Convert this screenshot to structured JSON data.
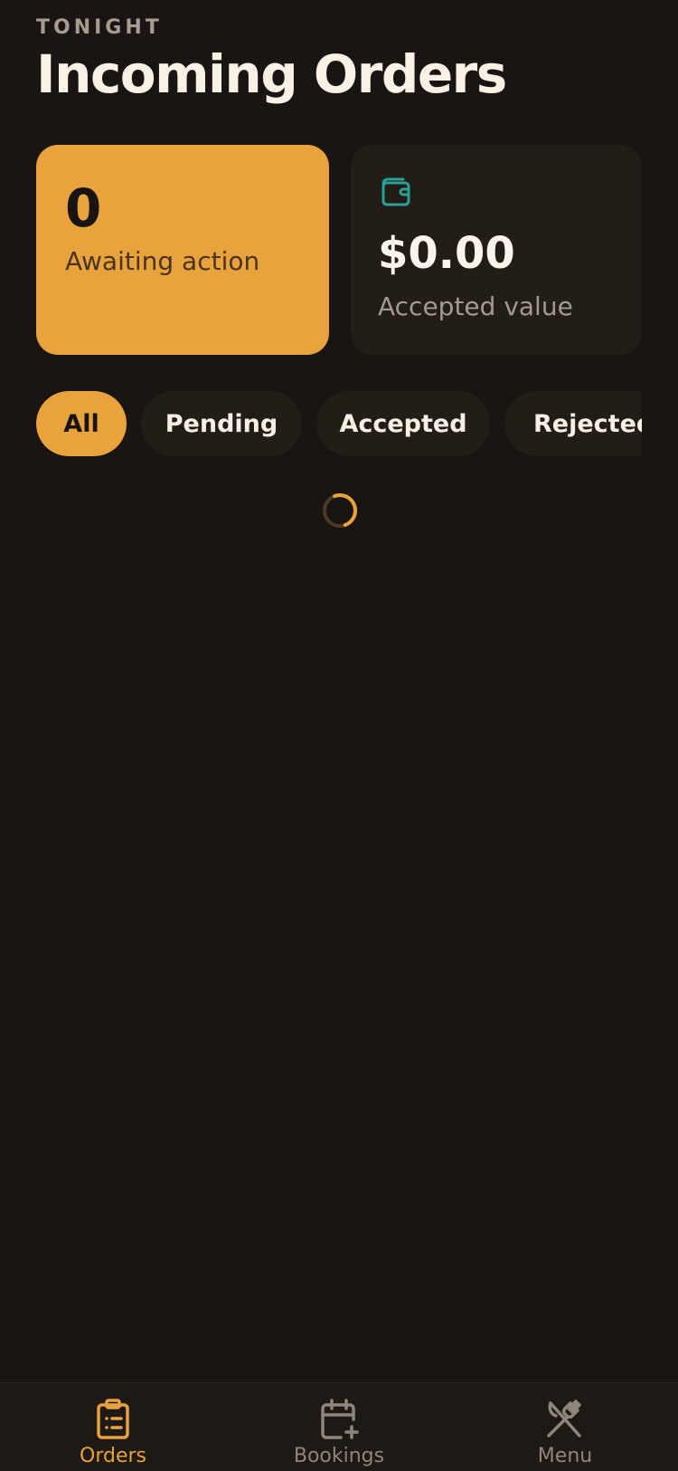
{
  "header": {
    "eyebrow": "TONIGHT",
    "title": "Incoming Orders"
  },
  "stats": {
    "awaiting": {
      "count": "0",
      "label": "Awaiting action"
    },
    "accepted": {
      "value": "$0.00",
      "label": "Accepted value",
      "icon": "wallet-icon"
    }
  },
  "filters": {
    "selected": "All",
    "chips": [
      "All",
      "Pending",
      "Accepted",
      "Rejected"
    ]
  },
  "bottom_nav": {
    "active": "Orders",
    "items": [
      {
        "label": "Orders",
        "icon": "clipboard-list-icon"
      },
      {
        "label": "Bookings",
        "icon": "calendar-plus-icon"
      },
      {
        "label": "Menu",
        "icon": "utensils-crossed-icon"
      }
    ]
  },
  "colors": {
    "background": "#1a1512",
    "accent": "#e8a33d",
    "card": "#231d18",
    "teal": "#2aa198",
    "muted_text": "#a39a8f"
  }
}
